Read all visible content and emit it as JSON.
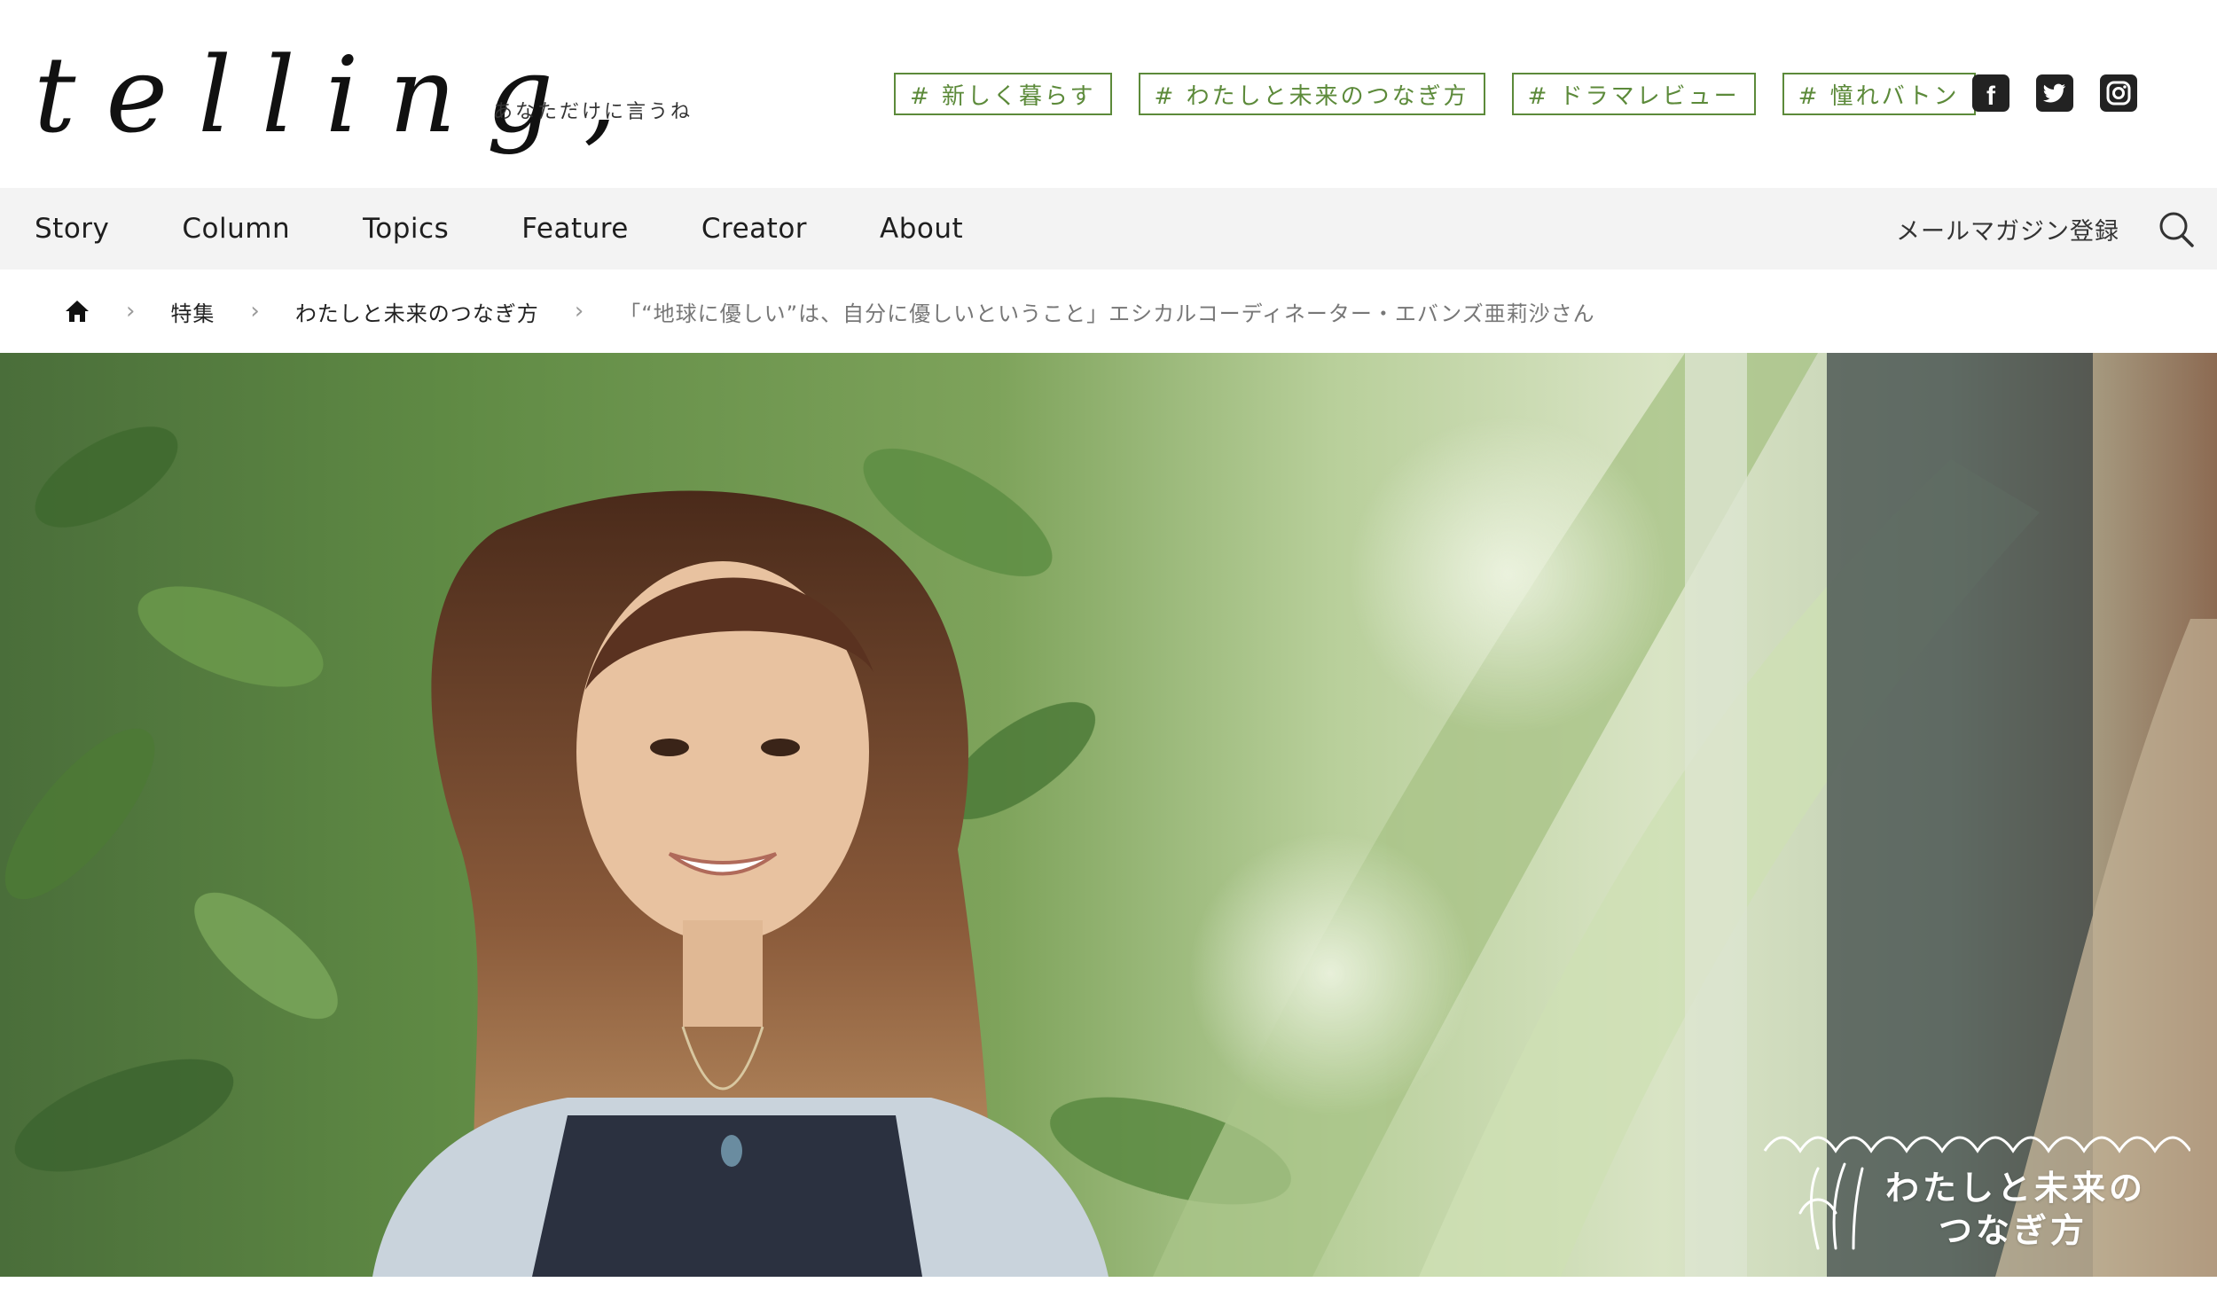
{
  "site": {
    "logo": "telling,",
    "tagline": "あなただけに言うね"
  },
  "tags": [
    {
      "label": "# 新しく暮らす"
    },
    {
      "label": "# わたしと未来のつなぎ方"
    },
    {
      "label": "# ドラマレビュー"
    },
    {
      "label": "# 憧れバトン"
    }
  ],
  "social": {
    "icons": [
      "facebook-icon",
      "twitter-icon",
      "instagram-icon"
    ]
  },
  "nav": {
    "items": [
      {
        "label": "Story"
      },
      {
        "label": "Column"
      },
      {
        "label": "Topics"
      },
      {
        "label": "Feature"
      },
      {
        "label": "Creator"
      },
      {
        "label": "About"
      }
    ],
    "newsletter": "メールマガジン登録",
    "search_icon": "search-icon"
  },
  "breadcrumb": {
    "home_icon": "home-icon",
    "items": [
      {
        "label": "特集"
      },
      {
        "label": "わたしと未来のつなぎ方"
      }
    ],
    "current": "「“地球に優しい”は、自分に優しいということ」エシカルコーディネーター・エバンズ亜莉沙さん"
  },
  "hero": {
    "badge_line1": "わたしと未来の",
    "badge_line2": "つなぎ方"
  },
  "colors": {
    "accent_green": "#5c8a3a",
    "nav_bg": "#f3f3f3"
  }
}
